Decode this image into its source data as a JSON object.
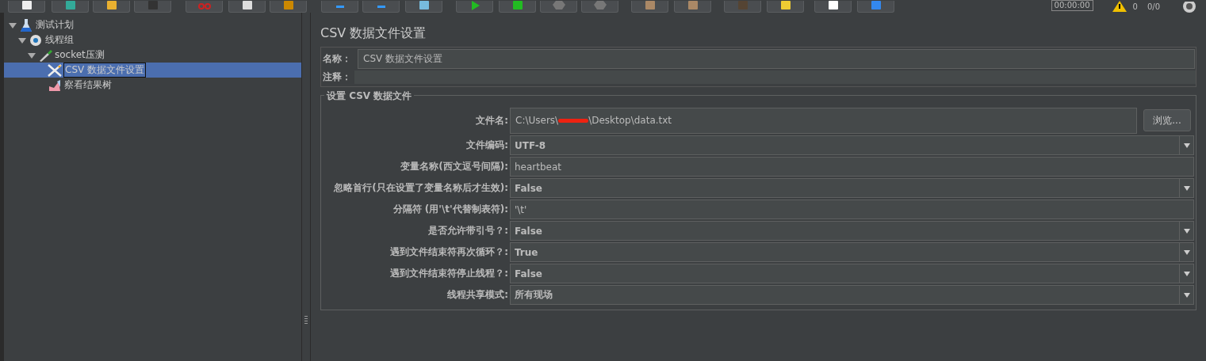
{
  "status": {
    "timer": "00:00:00",
    "warnings": "0",
    "threads": "0/0"
  },
  "tree": [
    {
      "label": "测试计划",
      "kind": "plan",
      "expanded": true,
      "selected": false,
      "children": [
        {
          "label": "线程组",
          "kind": "threads",
          "expanded": true,
          "selected": false,
          "children": [
            {
              "label": "socket压测",
              "kind": "sampler",
              "expanded": true,
              "selected": false,
              "children": [
                {
                  "label": "CSV 数据文件设置",
                  "kind": "config",
                  "selected": true
                },
                {
                  "label": "察看结果树",
                  "kind": "listener",
                  "selected": false
                }
              ]
            }
          ]
        }
      ]
    }
  ],
  "panel": {
    "title": "CSV 数据文件设置",
    "name": {
      "label": "名称：",
      "value": "CSV 数据文件设置"
    },
    "comment": {
      "label": "注释："
    },
    "group": {
      "title": "设置 CSV 数据文件",
      "rows": [
        {
          "kind": "file",
          "label": "文件名:",
          "value_start": "C:\\Users\\",
          "value_end": "\\Desktop\\data.txt",
          "redacted": true,
          "button": "浏览..."
        },
        {
          "kind": "combo",
          "label": "文件编码:",
          "value": "UTF-8"
        },
        {
          "kind": "text",
          "label": "变量名称(西文逗号间隔):",
          "value": "heartbeat"
        },
        {
          "kind": "combo",
          "label": "忽略首行(只在设置了变量名称后才生效):",
          "value": "False"
        },
        {
          "kind": "text",
          "label": "分隔符 (用'\\t'代替制表符):",
          "value": "'\\t'"
        },
        {
          "kind": "combo",
          "label": "是否允许带引号？:",
          "value": "False"
        },
        {
          "kind": "combo",
          "label": "遇到文件结束符再次循环？:",
          "value": "True"
        },
        {
          "kind": "combo",
          "label": "遇到文件结束符停止线程？:",
          "value": "False"
        },
        {
          "kind": "combo",
          "label": "线程共享模式:",
          "value": "所有现场"
        }
      ]
    }
  }
}
